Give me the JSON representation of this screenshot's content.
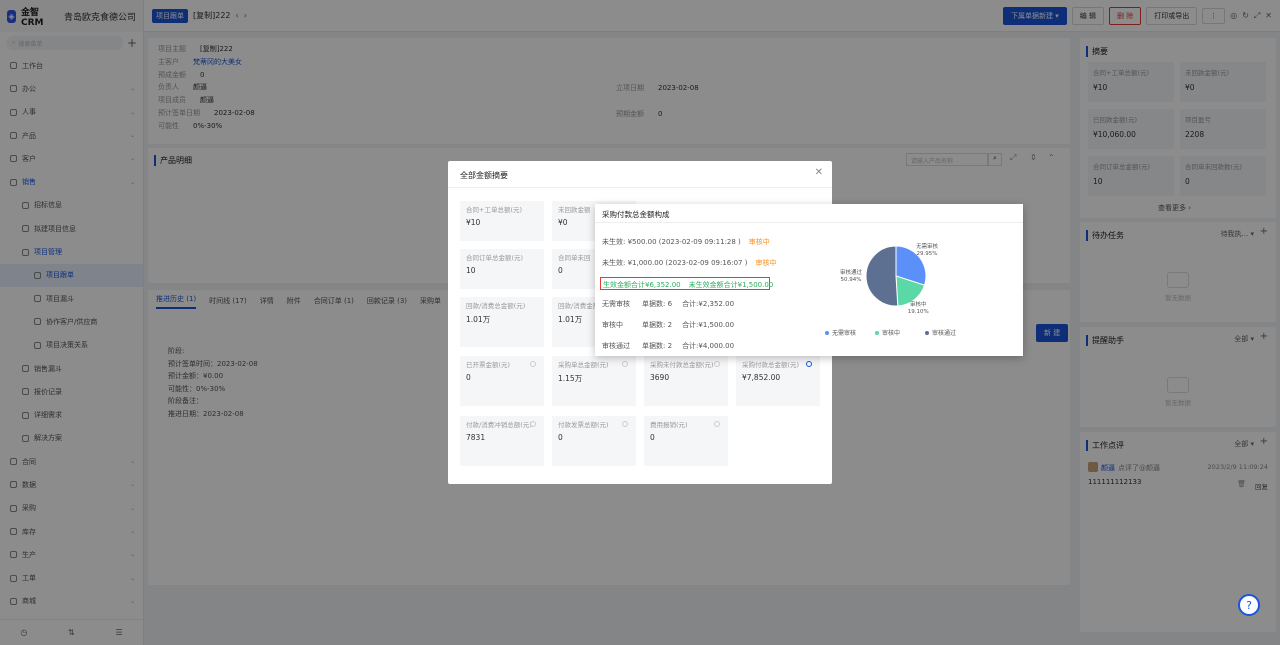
{
  "sidebar": {
    "brand": "金智CRM",
    "company": "青岛欧克食德公司",
    "search_placeholder": "搜索菜单",
    "items": [
      {
        "label": "工作台",
        "level": 0
      },
      {
        "label": "办公",
        "level": 0
      },
      {
        "label": "人事",
        "level": 0
      },
      {
        "label": "产品",
        "level": 0
      },
      {
        "label": "客户",
        "level": 0
      },
      {
        "label": "销售",
        "level": 0
      },
      {
        "label": "招标信息",
        "level": 1
      },
      {
        "label": "拟建项目信息",
        "level": 1
      },
      {
        "label": "项目管理",
        "level": 1
      },
      {
        "label": "项目跟单",
        "level": 2
      },
      {
        "label": "项目漏斗",
        "level": 2
      },
      {
        "label": "协作客户/供应商",
        "level": 2
      },
      {
        "label": "项目决策关系",
        "level": 2
      },
      {
        "label": "销售漏斗",
        "level": 1
      },
      {
        "label": "报价记录",
        "level": 1
      },
      {
        "label": "详细需求",
        "level": 1
      },
      {
        "label": "解决方案",
        "level": 1
      },
      {
        "label": "合同",
        "level": 0
      },
      {
        "label": "数据",
        "level": 0
      },
      {
        "label": "采购",
        "level": 0
      },
      {
        "label": "库存",
        "level": 0
      },
      {
        "label": "生产",
        "level": 0
      },
      {
        "label": "工单",
        "level": 0
      },
      {
        "label": "商城",
        "level": 0
      },
      {
        "label": "应用",
        "level": 0
      }
    ]
  },
  "topbar": {
    "tag": "项目跟单",
    "title": "[复制]222",
    "actions": {
      "create_below": "下属单据新建",
      "edit": "编 辑",
      "delete": "删 除",
      "print": "打印或导出",
      "more": "⋮"
    }
  },
  "record": {
    "fields_left": [
      {
        "label": "项目主题",
        "value": "[复制]222"
      },
      {
        "label": "主客户",
        "value": "梵蒂冈的大美女"
      },
      {
        "label": "预成金额",
        "value": "0"
      },
      {
        "label": "负责人",
        "value": "颜逼"
      },
      {
        "label": "项目成员",
        "value": "颜逼"
      },
      {
        "label": "预计签单日期",
        "value": "2023-02-08"
      },
      {
        "label": "可能性",
        "value": "0%-30%"
      }
    ],
    "fields_right": [
      {
        "label": "立项日期",
        "value": "2023-02-08"
      },
      {
        "label": "预期金额",
        "value": "0"
      }
    ],
    "product_section_title": "产品明细",
    "product_search_placeholder": "请输入产品名称",
    "tabs": [
      "推进历史 (1)",
      "时间线 (17)",
      "详情",
      "附件",
      "合同订单 (1)",
      "回款记录 (3)",
      "采购单"
    ],
    "new_button": "新 建",
    "stage": {
      "title": "阶段:",
      "lines": [
        "预计签单时间：2023-02-08",
        "预计金额：¥0.00",
        "可能性：0%-30%",
        "阶段备注：",
        "推进日期：2023-02-08"
      ]
    }
  },
  "right_panel": {
    "summary": {
      "title": "摘要",
      "cards": [
        {
          "label": "合同+工单总额(元)",
          "value": "¥10"
        },
        {
          "label": "未回款金额(元)",
          "value": "¥0"
        },
        {
          "label": "已回款金额(元)",
          "value": "¥10,060.00"
        },
        {
          "label": "项目盈亏",
          "value": "2208"
        },
        {
          "label": "合同订单总金额(元)",
          "value": "10"
        },
        {
          "label": "合同单未回款数(元)",
          "value": "0"
        }
      ],
      "more": "查看更多"
    },
    "todo": {
      "title": "待办任务",
      "filter": "待我执...",
      "empty": "暂无数据"
    },
    "reminder": {
      "title": "提醒助手",
      "filter": "全部",
      "empty": "暂无数据"
    },
    "comments": {
      "title": "工作点评",
      "filter": "全部",
      "author": "颜逼",
      "action": "点评了@颜逼",
      "time": "2023/2/9 11:09:24",
      "content": "111111112133",
      "reply": "回复"
    }
  },
  "modal": {
    "title": "全部金额摘要",
    "cards": [
      {
        "label": "合同+工单总额(元)",
        "value": "¥10"
      },
      {
        "label": "未回款金额",
        "value": "¥0"
      },
      {
        "label": "合同订单总金额(元)",
        "value": "10"
      },
      {
        "label": "合同单未回",
        "value": "0"
      },
      {
        "label": "回款/消费总金额(元)",
        "value": "1.01万"
      },
      {
        "label": "回款/消费金额(元)",
        "value": "1.01万"
      },
      {
        "label": "已开票金额(元)",
        "value": "0"
      },
      {
        "label": "采购单总金额(元)",
        "value": "1.15万"
      },
      {
        "label": "采购未付款总金额(元)",
        "value": "3690"
      },
      {
        "label": "采购付款总金额(元)",
        "value": "¥7,852.00"
      },
      {
        "label": "付款/消费冲销总额(元)",
        "value": "7831"
      },
      {
        "label": "付款发票总额(元)",
        "value": "0"
      },
      {
        "label": "费用报销(元)",
        "value": "0"
      }
    ]
  },
  "popover": {
    "title": "采购付款总金额构成",
    "rows": [
      {
        "text": "未生效: ¥500.00 (2023-02-09 09:11:28 )",
        "status": "审核中"
      },
      {
        "text": "未生效: ¥1,000.00 (2023-02-09 09:16:07 )",
        "status": "审核中"
      }
    ],
    "effective": "生效金额合计¥6,352.00",
    "not_effective": "未生效金额合计¥1,500.00",
    "groups": [
      {
        "name": "无需审核",
        "count_label": "单据数:",
        "count": "6",
        "total_label": "合计:",
        "total": "¥2,352.00"
      },
      {
        "name": "审核中",
        "count_label": "单据数:",
        "count": "2",
        "total_label": "合计:",
        "total": "¥1,500.00"
      },
      {
        "name": "审核通过",
        "count_label": "单据数:",
        "count": "2",
        "total_label": "合计:",
        "total": "¥4,000.00"
      }
    ]
  },
  "chart_data": {
    "type": "pie",
    "categories": [
      "无需审核",
      "审核中",
      "审核通过"
    ],
    "values": [
      29.95,
      19.1,
      50.94
    ],
    "value_labels": [
      "29.95%",
      "19.10%",
      "50.94%"
    ],
    "colors": [
      "#5b8ff9",
      "#5ad8a6",
      "#5d7092"
    ],
    "legend_position": "bottom"
  },
  "help_icon": "?"
}
